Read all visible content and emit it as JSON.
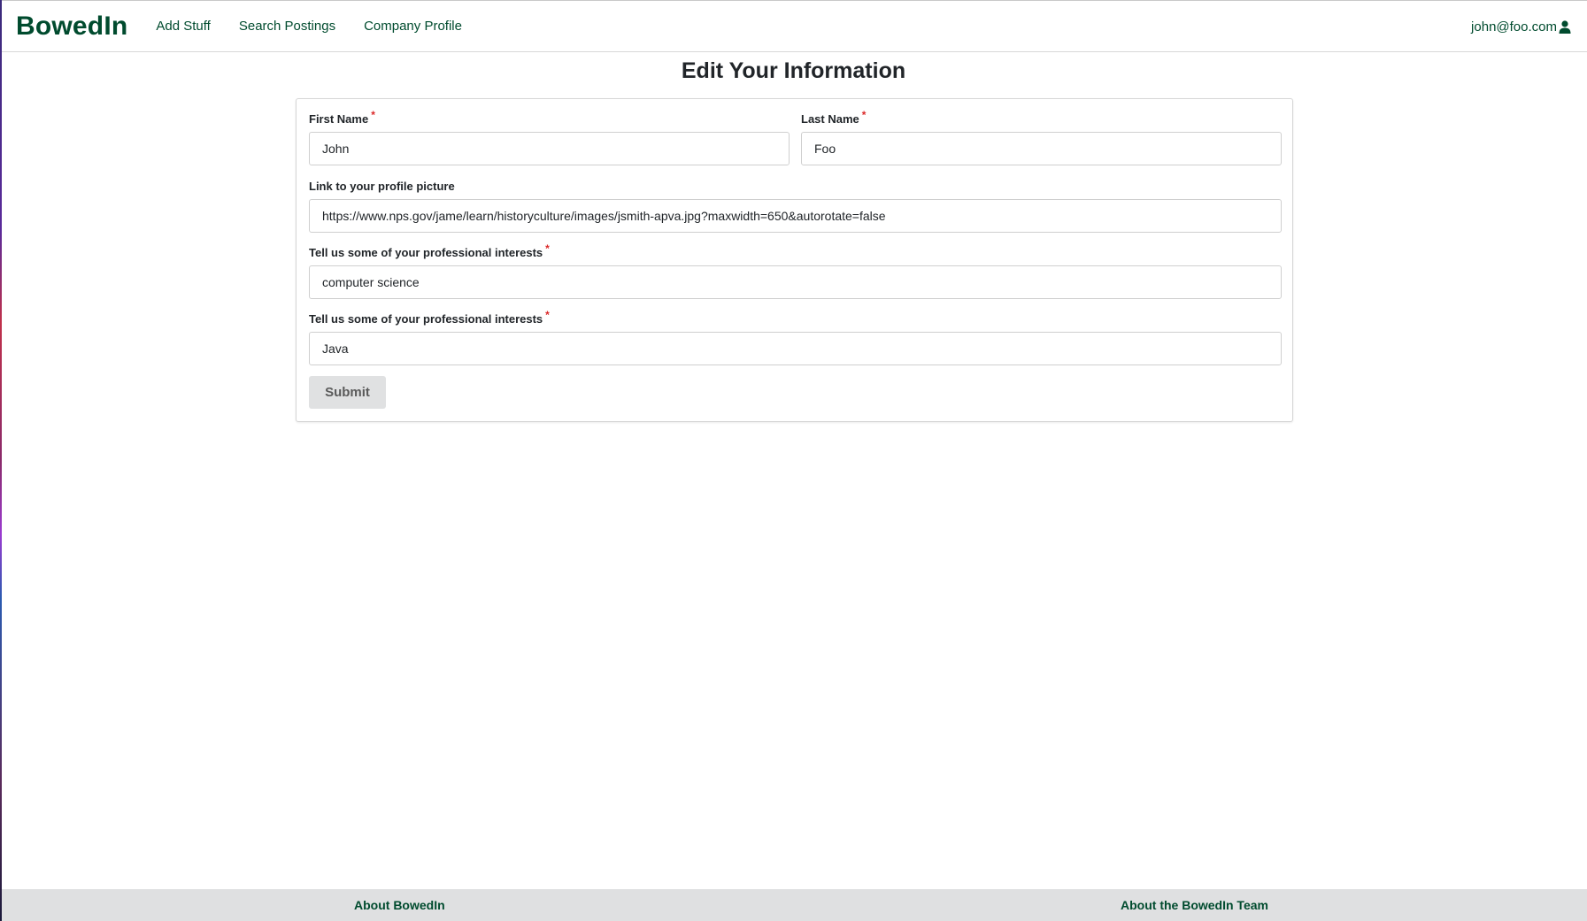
{
  "navbar": {
    "brand": "BowedIn",
    "links": [
      "Add Stuff",
      "Search Postings",
      "Company Profile"
    ],
    "user_email": "john@foo.com",
    "user_icon": "user-icon"
  },
  "page": {
    "title": "Edit Your Information"
  },
  "form": {
    "first_name": {
      "label": "First Name",
      "value": "John",
      "required_marker": "*"
    },
    "last_name": {
      "label": "Last Name",
      "value": "Foo",
      "required_marker": "*"
    },
    "picture_link": {
      "label": "Link to your profile picture",
      "value": "https://www.nps.gov/jame/learn/historyculture/images/jsmith-apva.jpg?maxwidth=650&autorotate=false"
    },
    "interests": {
      "label": "Tell us some of your professional interests",
      "value": "computer science",
      "required_marker": "*"
    },
    "skills": {
      "label": "Tell us some of your professional interests",
      "value": "Java",
      "required_marker": "*"
    },
    "submit_label": "Submit"
  },
  "footer": {
    "about": "About BowedIn",
    "team": "About the BowedIn Team"
  },
  "colors": {
    "brand": "#004b2e",
    "required": "#db2828",
    "footer_bg": "#dfe0e1",
    "button_bg": "#e0e1e2"
  }
}
